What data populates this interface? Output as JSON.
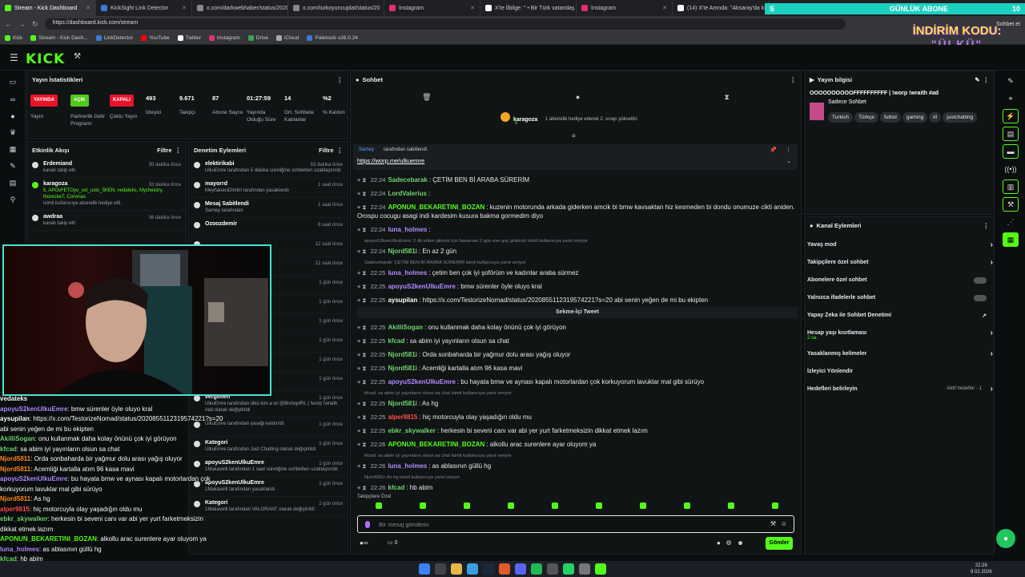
{
  "browser": {
    "tabs": [
      {
        "label": "Stream - Kick Dashboard",
        "color": "#53fc18"
      },
      {
        "label": "KickSight Link Detector",
        "color": "#3a7bd5"
      },
      {
        "label": "x.com/darkwebhaber/status/2020",
        "color": "#888888"
      },
      {
        "label": "x.com/turkoyuncuplat/status/20",
        "color": "#888888"
      },
      {
        "label": "Instagram",
        "color": "#e1306c"
      },
      {
        "label": "X'te İlbilge: \" • Bir Türk vatandaş",
        "color": "#ffffff"
      },
      {
        "label": "Instagram",
        "color": "#e1306c"
      },
      {
        "label": "(14) X'te Amnda: \"Aksaray'da küçü",
        "color": "#ffffff"
      }
    ],
    "url": "https://dashboard.kick.com/stream",
    "bookmarks": [
      "Kick",
      "Stream - Kick Dash...",
      "LinkDetector",
      "YouTube",
      "Twitter",
      "Instagram",
      "Drive",
      "iCloud",
      "Paletools v26.0.24"
    ],
    "right_label": "Sohbet et"
  },
  "overlay": {
    "banner_left": "S",
    "banner_text": "GÜNLÜK ABONE",
    "banner_count": "10",
    "promo_line1": "İNDİRİM KODU:",
    "promo_line2": "\"ÜLKÜ\""
  },
  "header": {
    "logo": "KICK"
  },
  "stats": {
    "title": "Yayın İstatistikleri",
    "items": [
      {
        "pill": "YAYINDA",
        "pill_color": "#e8142a",
        "label": "Yayın"
      },
      {
        "pill": "AÇIK",
        "pill_color": "#53c818",
        "label": "Partnerlik Gelir Programı"
      },
      {
        "pill": "KAPALI",
        "pill_color": "#e8142a",
        "label": "Çoklu Yayın"
      },
      {
        "value": "493",
        "label": "İzleyici"
      },
      {
        "value": "9.671",
        "label": "Takipçi"
      },
      {
        "value": "87",
        "label": "Abone Sayısı"
      },
      {
        "value": "01:27:59",
        "label": "Yayında Olduğu Süre"
      },
      {
        "value": "14",
        "label": "Ort. Sohbete Katılanlar"
      },
      {
        "value": "%2",
        "label": "% Katılım"
      }
    ]
  },
  "activity": {
    "title": "Etkinlik Akışı",
    "filter": "Filtre",
    "items": [
      {
        "name": "Erdemiand",
        "sub": "kanalı takip etti",
        "time": "30 dakika önce"
      },
      {
        "name": "karagoza",
        "sub": "isimli kullanıcıya abonelik hediye etti.",
        "extra": "5. APOvFETOyu_ust_usto_5KEN, vedateks, Mycheistry, thoreckeT, Corvinas",
        "time": "33 dakika önce"
      },
      {
        "name": "awdraa",
        "sub": "kanalı takip etti",
        "time": "36 dakika önce"
      }
    ]
  },
  "mod": {
    "title": "Denetim Eylemleri",
    "filter": "Filtre",
    "items": [
      {
        "name": "elektirikabi",
        "sub": "UlkuEmre tarafından 5 dakika süreliğine sohbetten uzaklaştırıldı",
        "time": "53 dakika önce"
      },
      {
        "name": "mayorrd",
        "sub": "MeyhaneciDimitri tarafından yasaklandı",
        "time": "1 saat önce"
      },
      {
        "name": "Mesaj Sabitlendi",
        "sub": "Sarney tarafından",
        "time": "1 saat önce"
      },
      {
        "name": "Ozoozdemir",
        "sub": "",
        "time": "6 saat önce"
      },
      {
        "name": "",
        "sub": "",
        "time": "12 saat önce"
      },
      {
        "name": "",
        "sub": "",
        "time": "12 saat önce"
      },
      {
        "name": "",
        "sub": "",
        "time": "1 gün önce"
      },
      {
        "name": "",
        "sub": "",
        "time": "1 gün önce"
      },
      {
        "name": "",
        "sub": "",
        "time": "1 gün önce"
      },
      {
        "name": "",
        "sub": "| !worp !wraith #ad olarak",
        "time": "1 gün önce"
      },
      {
        "name": "",
        "sub": "",
        "time": "1 gün önce"
      },
      {
        "name": "",
        "sub": "",
        "time": "1 gün önce"
      },
      {
        "name": "vergimen",
        "sub": "UlkuEmre tarafından ülkü kim a w/ @BishopIRL | !worp !wraith #ad olarak değiştirildi",
        "time": "1 gün önce"
      },
      {
        "name": "",
        "sub": "UlkuEmre tarafından yasağı kaldırıldı",
        "time": "1 gün önce"
      },
      {
        "name": "Kategori",
        "sub": "UlkuEmre tarafından Just Chatting olarak değiştirildi",
        "time": "1 gün önce"
      },
      {
        "name": "apoyuS2kenUlkuEmre",
        "sub": "1Makavelli tarafından 1 saat süreliğine sohbetten uzaklaştırıldı",
        "time": "1 gün önce"
      },
      {
        "name": "apoyuS2kenUlkuEmre",
        "sub": "1Makavelli tarafından yasaklandı",
        "time": "1 gün önce"
      },
      {
        "name": "Kategori",
        "sub": "1Makavelli tarafından VALORANT olarak değiştirildi",
        "time": "1 gün önce"
      }
    ]
  },
  "chat": {
    "title": "Sohbet",
    "gift_user": "karagoza",
    "gift_count": "5",
    "gift_text": "1 abonelik hediye ederek 2. sırayı yükseltin",
    "pinned_by": "Sarney",
    "pinned_label": "tarafından sabitlendi",
    "pinned_link": "https://worp.me/ulkuemre",
    "tweet_label": "Sekme-İçi Tweet",
    "messages": [
      {
        "time": "22:24",
        "user": "Sadecebarak",
        "color": "#6fd46f",
        "text": "ÇETİM BEN Bİ ARABA SÜRERİM"
      },
      {
        "time": "22:24",
        "user": "LordValerius",
        "color": "#6fd46f",
        "text": ""
      },
      {
        "time": "22:24",
        "user": "APONUN_BEKARETINI_BOZAN",
        "color": "#53fc18",
        "text": "kuzenin motorunda arkada giderken amcik bi bmw kavsaktan hiz kesmeden bi dondu onumuze cikti aniden. Orospu cocugu asagi indi kardesim kusura bakma gormedim diyo"
      },
      {
        "time": "22:24",
        "user": "luna_holmes",
        "color": "#b38cff",
        "text": ""
      },
      {
        "reply": "apoyuS2kenUlkuEmre: 2 dk erken gitmek için basarsan 2 gün eve geç gidersin isimli kullanıcıya yanıt veriyor"
      },
      {
        "time": "22:24",
        "user": "Njord581i",
        "color": "#6fd46f",
        "text": "En az 2 gün"
      },
      {
        "reply": "Sadecebarak: ÇETİM BEN Bİ ARABA SÜRERİM isimli kullanıcıya yanıt veriyor"
      },
      {
        "time": "22:25",
        "user": "luna_holmes",
        "color": "#b38cff",
        "text": "çetim ben çok iyi şoförüm ve kadınlar araba sürmez"
      },
      {
        "time": "22:25",
        "user": "apoyuS2kenUlkuEmre",
        "color": "#b38cff",
        "text": "bmw sürenler öyle oluyo kral"
      },
      {
        "time": "22:25",
        "user": "aysupilan",
        "color": "#ffffff",
        "text": "https://x.com/TestorizeNomad/status/2020855112319574221?s=20 abi senin yeğen de mi bu ekipten"
      },
      {
        "time": "22:25",
        "user": "AkilliSogan",
        "color": "#6fd46f",
        "text": "onu kullanmak daha kolay önünü çok iyi görüyon"
      },
      {
        "time": "22:25",
        "user": "kfcad",
        "color": "#6fd46f",
        "text": "sa abim iyi yayınların olsun sa chat"
      },
      {
        "time": "22:25",
        "user": "Njord581i",
        "color": "#6fd46f",
        "text": "Orda sonbaharda bir yağmur dolu arası yağış oluyor"
      },
      {
        "time": "22:25",
        "user": "Njord581i",
        "color": "#6fd46f",
        "text": "Acemliği kartalla atım 96 kasa mavi"
      },
      {
        "time": "22:25",
        "user": "apoyuS2kenUlkuEmre",
        "color": "#b38cff",
        "text": "bu hayata bmw ve aynası kapalı motorlardan çok korkuyorum lavuklar mal gibi sürüyo"
      },
      {
        "reply": "kfcad: sa abim iyi yayınların olsun sa chat isimli kullanıcıya yanıt veriyor"
      },
      {
        "time": "22:25",
        "user": "Njord581i",
        "color": "#6fd46f",
        "text": "As hg"
      },
      {
        "time": "22:25",
        "user": "alper9815",
        "color": "#ff4d4d",
        "text": "hiç motorcuyla olay yaşadığın oldu mu"
      },
      {
        "time": "22:25",
        "user": "ebkr_skywalker",
        "color": "#6fd46f",
        "text": "herkesin bi seveni canı var abi yer yurt farketmeksizin dikkat etmek lazım"
      },
      {
        "time": "22:26",
        "user": "APONUN_BEKARETINI_BOZAN",
        "color": "#53fc18",
        "text": "alkollu arac surenlere ayar oluyom ya"
      },
      {
        "reply": "kfcad: sa abim iyi yayınların olsun sa chat isimli kullanıcıya yanıt veriyor"
      },
      {
        "time": "22:26",
        "user": "luna_holmes",
        "color": "#b38cff",
        "text": "as ablasının güllü hg"
      },
      {
        "reply": "Njord581i: As hg isimli kullanıcıya yanıt veriyor"
      },
      {
        "time": "22:26",
        "user": "kfcad",
        "color": "#6fd46f",
        "text": "hb abim"
      }
    ],
    "followers_label": "Takipçilere Özel",
    "input_placeholder": "Bir mesaj gönderin",
    "viewer_count": "0",
    "send_label": "Gönder"
  },
  "stream_info": {
    "title": "Yayın bilgisi",
    "stream_title": "OOOOOOOOOOFFFFFFFFFF | !worp !wraith #ad",
    "category": "Sadece Sohbet",
    "tags": [
      "Turkish",
      "Türkçe",
      "futbol",
      "gaming",
      "irl",
      "justchatting"
    ]
  },
  "channel_actions": {
    "title": "Kanal Eylemleri",
    "items": [
      {
        "label": "Yavaş mod",
        "kind": "arrow"
      },
      {
        "label": "Takipçilere özel sohbet",
        "kind": "arrow"
      },
      {
        "label": "Abonelere özel sohbet",
        "kind": "toggle"
      },
      {
        "label": "Yalnızca ifadelerle sohbet",
        "kind": "toggle"
      },
      {
        "label": "Yapay Zeka ile Sohbet Denetimi",
        "kind": "link"
      },
      {
        "label": "Hesap yaşı kısıtlaması",
        "sub": "2 sa.",
        "kind": "arrow"
      },
      {
        "label": "Yasaklanmış kelimeler",
        "kind": "arrow"
      },
      {
        "label": "İzleyici Yönlendir",
        "kind": "none"
      },
      {
        "label": "Hedefleri belirleyin",
        "sub": "Aktif hedefler - 1",
        "kind": "arrow"
      }
    ]
  },
  "overlay_chat": [
    {
      "user": "vedateks",
      "color": "#ffffff",
      "text": ""
    },
    {
      "user": "apoyuS2kenUlkuEmre",
      "color": "#b38cff",
      "text": ": bmw sürenler öyle oluyo kral"
    },
    {
      "user": "aysupilan",
      "color": "#ffffff",
      "text": ": https://x.com/TestorizeNomad/status/2020855112319574221?s=20"
    },
    {
      "user": "",
      "color": "#ffffff",
      "text": "abi senin yeğen de mi bu ekipten"
    },
    {
      "user": "AkilliSogan",
      "color": "#6fd46f",
      "text": ": onu kullanmak daha kolay önünü çok iyi görüyon"
    },
    {
      "user": "kfcad",
      "color": "#6fd46f",
      "text": ": sa abim iyi yayınların olsun sa chat"
    },
    {
      "user": "Njord5811",
      "color": "#ff8c1a",
      "text": ": Orda sonbaharda bir yağmur dolu arası yağış oluyor"
    },
    {
      "user": "Njord5811",
      "color": "#ff8c1a",
      "text": ": Acemliği kartalla atım 96 kasa mavi"
    },
    {
      "user": "apoyuS2kenUlkuEmre",
      "color": "#b38cff",
      "text": ": bu hayata bmw ve aynası kapalı motorlardan çok"
    },
    {
      "user": "",
      "color": "#ffffff",
      "text": "korkuyorum lavuklar mal gibi sürüyo"
    },
    {
      "user": "Njord5811",
      "color": "#ff8c1a",
      "text": ": As hg"
    },
    {
      "user": "alper9815",
      "color": "#ff4d4d",
      "text": ": hiç motorcuyla olay yaşadığın oldu mu"
    },
    {
      "user": "ebkr_skywalker",
      "color": "#6fd46f",
      "text": ": herkesin bi seveni canı var abi yer yurt farketmeksizin"
    },
    {
      "user": "",
      "color": "#ffffff",
      "text": "dikkat etmek lazım"
    },
    {
      "user": "APONUN_BEKARETINI_BOZAN",
      "color": "#53fc18",
      "text": ": alkollu arac surenlere ayar oluyom ya"
    },
    {
      "user": "luna_holmes",
      "color": "#b38cff",
      "text": ": as ablasının güllü hg"
    },
    {
      "user": "kfcad",
      "color": "#6fd46f",
      "text": ": hb abim"
    }
  ],
  "taskbar": {
    "time": "22:26",
    "date": "9.02.2026"
  }
}
